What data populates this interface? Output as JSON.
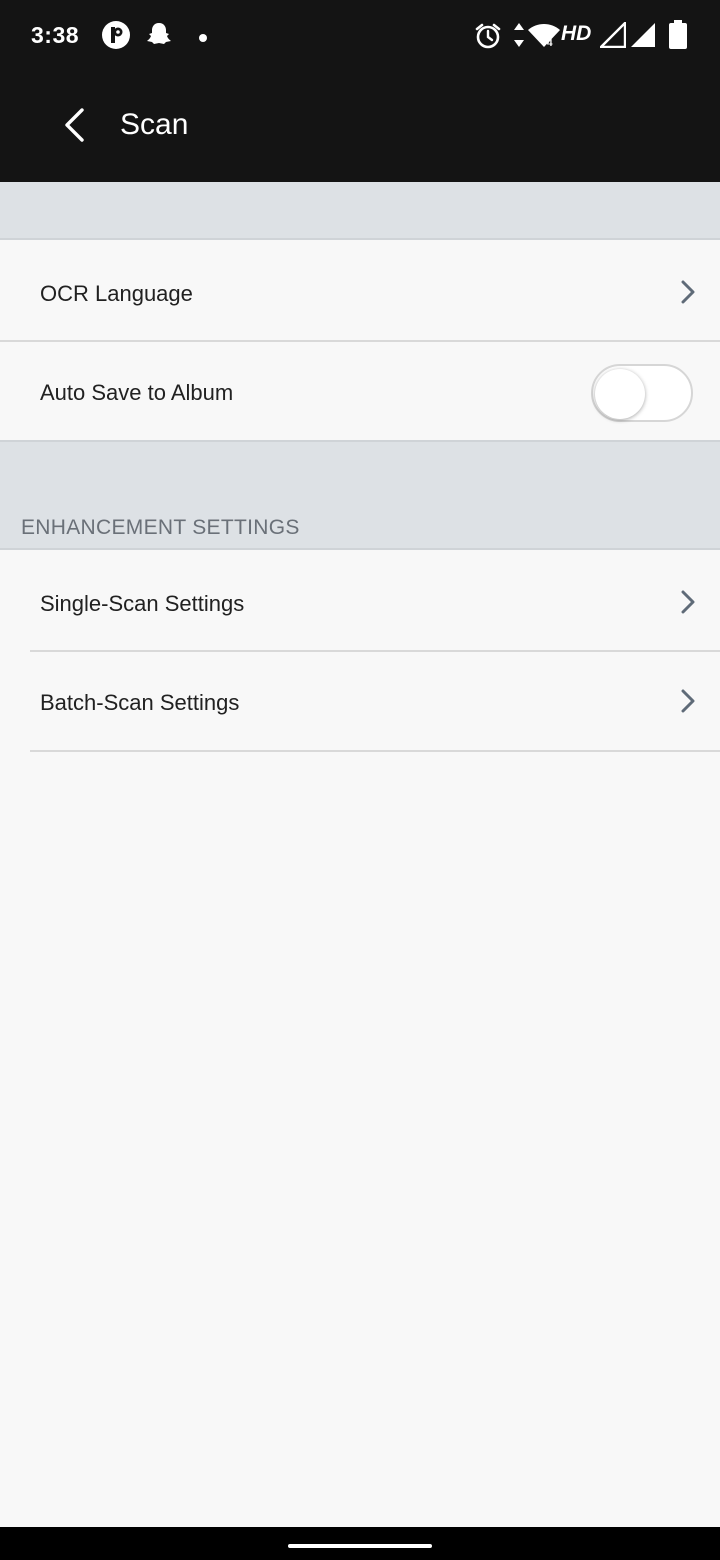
{
  "status_bar": {
    "time": "3:38",
    "hd_label": "HD",
    "network_label": "4",
    "icons": [
      "p-app-icon",
      "snapchat-icon",
      "dot-icon",
      "alarm-icon",
      "data-arrows-icon",
      "wifi-icon",
      "signal-icon",
      "signal-icon",
      "battery-icon"
    ]
  },
  "app_bar": {
    "title": "Scan",
    "back_icon": "chevron-left-icon"
  },
  "rows": {
    "ocr_language": {
      "label": "OCR Language"
    },
    "auto_save": {
      "label": "Auto Save to Album",
      "toggle_on": false
    }
  },
  "enhancement": {
    "header": "ENHANCEMENT SETTINGS",
    "single_scan": {
      "label": "Single-Scan Settings"
    },
    "batch_scan": {
      "label": "Batch-Scan Settings"
    }
  },
  "colors": {
    "app_bar": "#141414",
    "band": "#dde1e5",
    "background": "#f8f8f8",
    "chevron": "#5f6b78"
  }
}
